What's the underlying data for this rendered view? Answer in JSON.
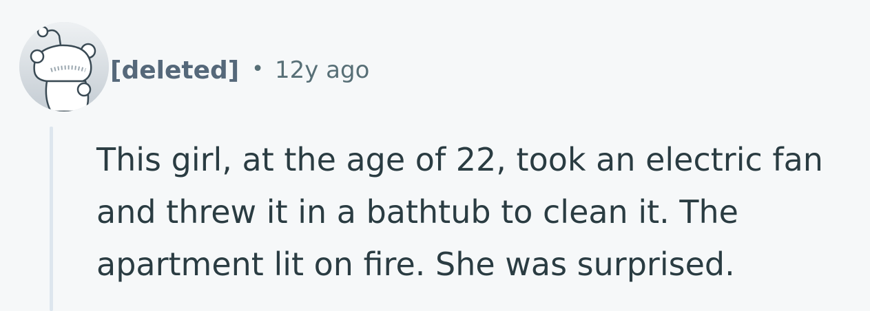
{
  "comment": {
    "avatar_icon": "snoo-avatar-icon",
    "author": "[deleted]",
    "separator": "•",
    "time_ago": "12y ago",
    "body_lines": [
      "This girl, at the age of 22, took an electric fan",
      "and threw it in a bathtub to clean it. The",
      "apartment lit on fire. She was surprised."
    ]
  },
  "colors": {
    "background": "#f6f8f9",
    "author": "#55687a",
    "meta": "#576f76",
    "body_text": "#2a3c42",
    "thread_line": "#dde6ee"
  }
}
